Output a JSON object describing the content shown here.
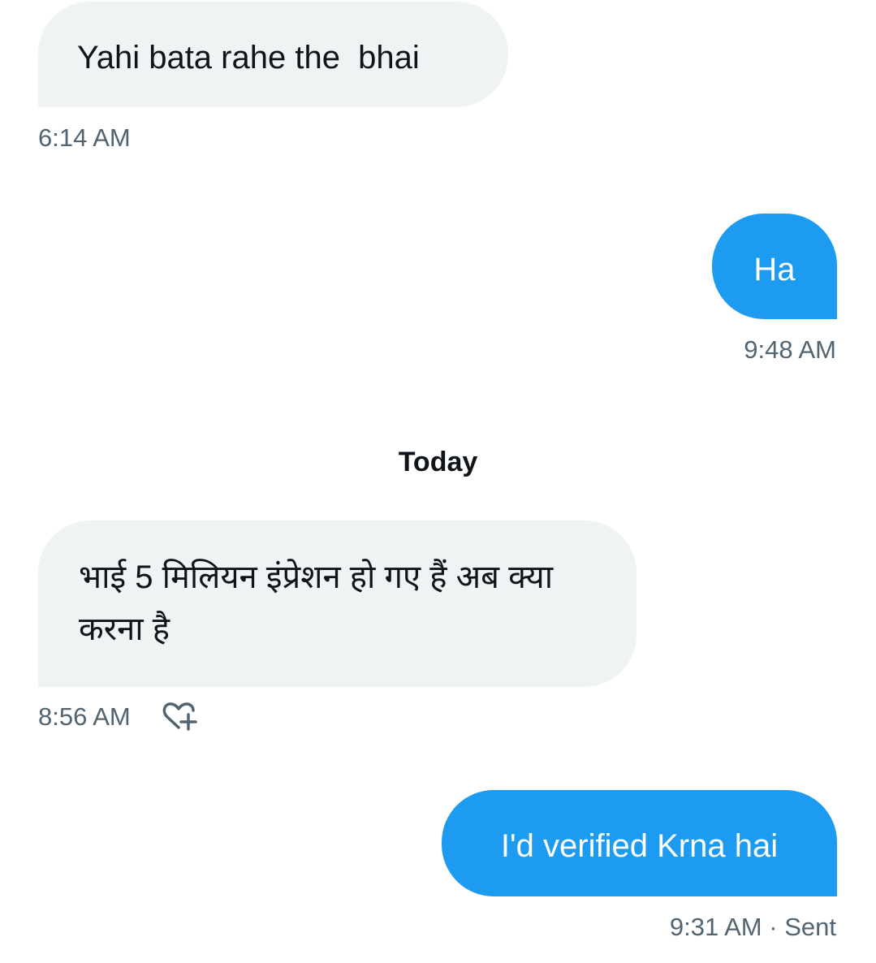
{
  "messages": [
    {
      "direction": "received",
      "text": "Yahi bata rahe the  bhai",
      "time": "6:14 AM"
    },
    {
      "direction": "sent",
      "text": "Ha",
      "time": "9:48 AM"
    },
    {
      "direction": "received",
      "text": "भाई 5 मिलियन इंप्रेशन हो गए हैं अब क्या करना है",
      "time": "8:56 AM"
    },
    {
      "direction": "sent",
      "text": "I'd verified Krna hai",
      "time": "9:31 AM",
      "status": "Sent"
    }
  ],
  "divider": {
    "label": "Today"
  },
  "status_separator": "·",
  "icons": {
    "react": "heart-plus-icon"
  },
  "colors": {
    "sent_bubble": "#1d9bf0",
    "received_bubble": "#eff3f4",
    "timestamp": "#536471",
    "text": "#0f1419"
  }
}
